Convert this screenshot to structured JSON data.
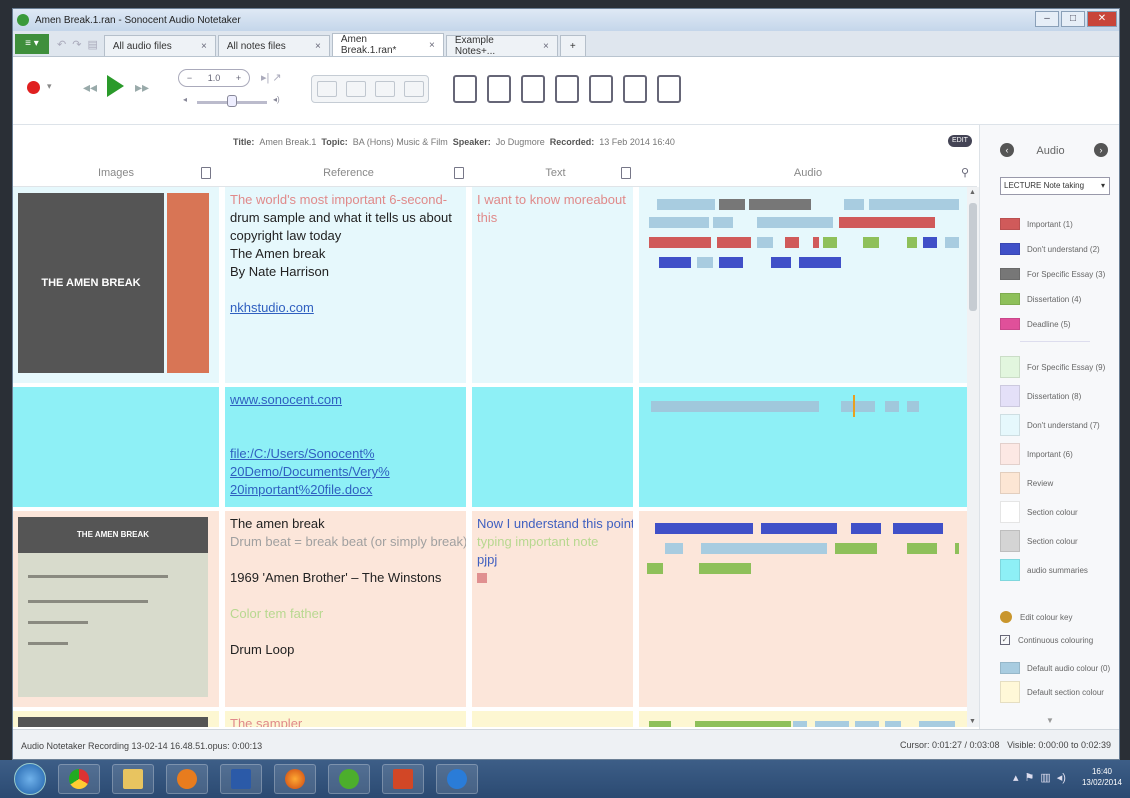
{
  "window": {
    "title": "Amen Break.1.ran - Sonocent Audio Notetaker"
  },
  "tabs": [
    {
      "label": "All audio files"
    },
    {
      "label": "All notes files"
    },
    {
      "label": "Amen Break.1.ran*",
      "active": true
    },
    {
      "label": "Example Notes+..."
    },
    {
      "label": "+"
    }
  ],
  "toolbar": {
    "speed": "1.0"
  },
  "info": {
    "title_label": "Title:",
    "title": "Amen Break.1",
    "topic_label": "Topic:",
    "topic": "BA (Hons) Music & Film",
    "speaker_label": "Speaker:",
    "speaker": "Jo Dugmore",
    "recorded_label": "Recorded:",
    "recorded": "13 Feb 2014 16:40",
    "edit": "EDIT"
  },
  "columns": {
    "images": "Images",
    "reference": "Reference",
    "text": "Text",
    "audio": "Audio"
  },
  "rows": [
    {
      "bg": "#e6f8fc",
      "img": {
        "title": "THE AMEN BREAK"
      },
      "reference": [
        [
          "The world's most important 6-second-",
          "pink"
        ],
        [
          "drum sample and what it tells us about",
          "dark"
        ],
        [
          "copyright law today",
          "dark"
        ],
        [
          "The Amen break",
          "dark"
        ],
        [
          "By Nate Harrison",
          "dark"
        ],
        [
          "",
          ""
        ],
        [
          "nkhstudio.com",
          "link"
        ]
      ],
      "text": [
        [
          "I want to know moreabout",
          "pink"
        ],
        [
          "this",
          "pink"
        ]
      ]
    },
    {
      "bg": "#8ef0f6",
      "reference": [
        [
          "www.sonocent.com",
          "link"
        ],
        [
          "",
          ""
        ],
        [
          "",
          ""
        ],
        [
          "file:/C:/Users/Sonocent%",
          "link"
        ],
        [
          "20Demo/Documents/Very%",
          "link"
        ],
        [
          "20important%20file.docx",
          "link"
        ]
      ],
      "text": []
    },
    {
      "bg": "#fce6da",
      "img": {
        "title": "THE AMEN BREAK"
      },
      "reference": [
        [
          "The amen break",
          "dark"
        ],
        [
          "Drum beat = break beat (or simply break)",
          "gray"
        ],
        [
          "",
          ""
        ],
        [
          "1969 'Amen Brother' – The Winstons",
          "dark"
        ],
        [
          "",
          ""
        ],
        [
          "Color tem father",
          "green"
        ],
        [
          "",
          ""
        ],
        [
          "Drum Loop",
          "dark"
        ]
      ],
      "text": [
        [
          "Now I understand this point",
          "blue"
        ],
        [
          "typing important note",
          "green"
        ],
        [
          "pjpj",
          "blue"
        ]
      ]
    },
    {
      "bg": "#fdf7d2",
      "reference": [
        [
          "The sampler",
          "pink"
        ]
      ],
      "text": []
    }
  ],
  "panel": {
    "header": "Audio",
    "prev": "‹",
    "next": "›",
    "dropdown": "LECTURE Note taking",
    "audio_keys": [
      {
        "label": "Important (1)",
        "color": "#d05a5a"
      },
      {
        "label": "Don't understand (2)",
        "color": "#4050c8"
      },
      {
        "label": "For Specific Essay (3)",
        "color": "#777777"
      },
      {
        "label": "Dissertation (4)",
        "color": "#8ec05a"
      },
      {
        "label": "Deadline (5)",
        "color": "#e0509a"
      }
    ],
    "section_keys": [
      {
        "label": "For Specific Essay (9)",
        "color": "#e2f6de"
      },
      {
        "label": "Dissertation (8)",
        "color": "#e4e0f8"
      },
      {
        "label": "Don't understand (7)",
        "color": "#e6f8fc"
      },
      {
        "label": "Important (6)",
        "color": "#fce8e4"
      },
      {
        "label": "Review",
        "color": "#fce6d4"
      },
      {
        "label": "Section colour",
        "color": "#ffffff"
      },
      {
        "label": "Section colour",
        "color": "#d4d4d4"
      },
      {
        "label": "audio summaries",
        "color": "#8ef0f6"
      }
    ],
    "edit_colour_key": "Edit colour key",
    "continuous": "Continuous colouring",
    "default_audio": {
      "label": "Default audio colour (0)",
      "color": "#a8cce0"
    },
    "default_section": {
      "label": "Default section colour",
      "color": "#fff8d8"
    }
  },
  "status": {
    "left": "Audio Notetaker Recording 13-02-14 16.48.51.opus: 0:00:13",
    "cursor": "Cursor: 0:01:27 / 0:03:08",
    "visible": "Visible: 0:00:00 to 0:02:39"
  },
  "taskbar": {
    "time": "16:40",
    "date": "13/02/2014"
  }
}
